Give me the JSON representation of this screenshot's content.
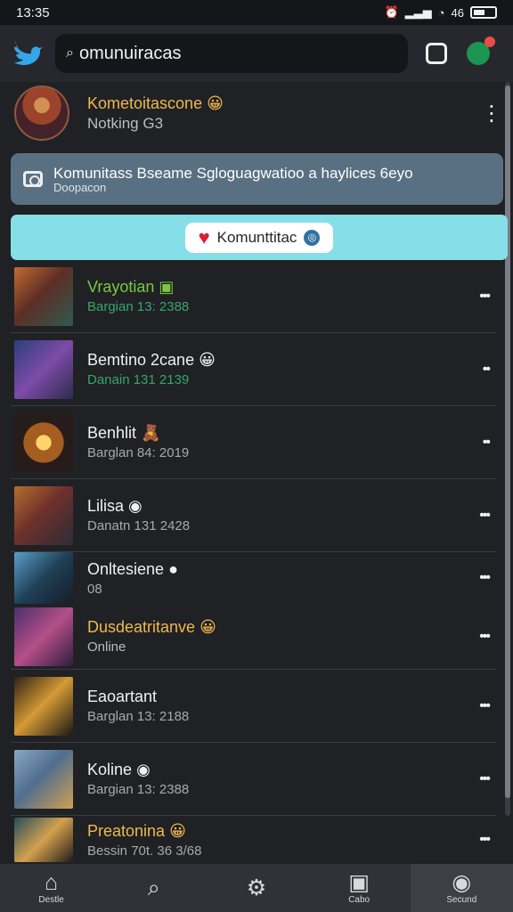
{
  "status": {
    "time": "13:35",
    "network": "46"
  },
  "header": {
    "search_value": "omunuiracas"
  },
  "profile": {
    "name": "Kometoitascone",
    "name_emoji": "😀",
    "subtitle": "Notking",
    "subtitle_tail": "G3"
  },
  "banner": {
    "main": "Komunitass Bseame Sgloguagwatioo a haylices 6eyo",
    "sub": "Doopacon"
  },
  "community_button": {
    "label": "Komunttitac",
    "badge_icon": "circle-badge-icon"
  },
  "rows": [
    {
      "title": "Vrayotian",
      "title_color": "#79c83f",
      "sub": "Bargian 13: 2388",
      "sub_color": "#37a669",
      "emoji": "▣",
      "menu": "•••"
    },
    {
      "title": "Bemtino 2cane",
      "title_color": "#f0f0f0",
      "sub": "Danain 131 2139",
      "sub_color": "#37a669",
      "emoji": "😀",
      "menu": "••"
    },
    {
      "title": "Benhlit",
      "title_color": "#f0f0f0",
      "sub": "Barglan 84: 2019",
      "sub_color": "#a9a9a9",
      "emoji": "🧸",
      "menu": "••"
    },
    {
      "title": "Lilisa",
      "title_color": "#f0f0f0",
      "sub": "Danatn 131 2428",
      "sub_color": "#a9a9a9",
      "emoji": "◉",
      "menu": "•••"
    },
    {
      "title": "Onltesiene",
      "title_color": "#f0f0f0",
      "sub": "08",
      "sub_color": "#a9a9a9",
      "emoji": "●",
      "menu": "•••"
    },
    {
      "title": "Dusdeatritanve",
      "title_color": "#f0b84b",
      "sub": "Online",
      "sub_color": "#bdbdbd",
      "emoji": "😀",
      "menu": "•••"
    },
    {
      "title": "Eaoartant",
      "title_color": "#f0f0f0",
      "sub": "Barglan 13: 2188",
      "sub_color": "#a9a9a9",
      "emoji": "",
      "menu": "•••"
    },
    {
      "title": "Koline",
      "title_color": "#f0f0f0",
      "sub": "Bargian 13: 2388",
      "sub_color": "#a9a9a9",
      "emoji": "◉",
      "menu": "•••"
    },
    {
      "title": "Preatonina",
      "title_color": "#f0b84b",
      "sub": "Bessin 70t. 36 3/68",
      "sub_color": "#a9a9a9",
      "emoji": "😀",
      "menu": "•••"
    }
  ],
  "bottom_nav": [
    {
      "label": "Destle",
      "icon": "home-icon"
    },
    {
      "label": "",
      "icon": "search-icon"
    },
    {
      "label": "",
      "icon": "settings-icon"
    },
    {
      "label": "Cabo",
      "icon": "camera-icon"
    },
    {
      "label": "Secund",
      "icon": "profile-icon"
    }
  ]
}
